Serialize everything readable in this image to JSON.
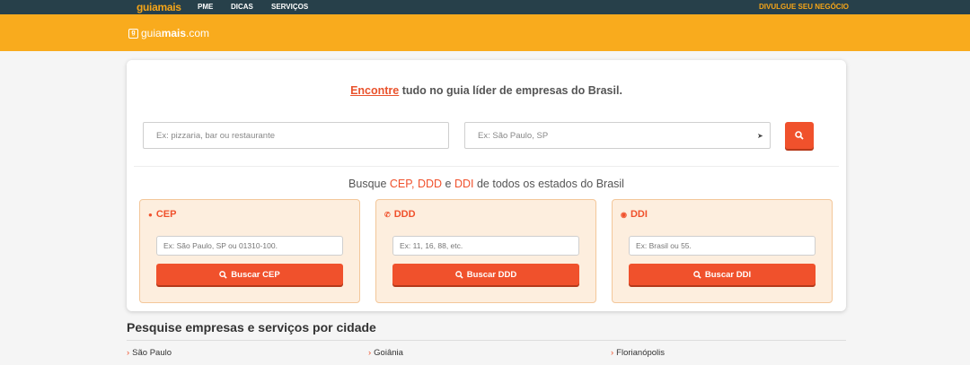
{
  "topbar": {
    "logo_a": "guia",
    "logo_b": "mais",
    "nav": [
      "PME",
      "DICAS",
      "SERVIÇOS"
    ],
    "promo": "DIVULGUE SEU NEGÓCIO"
  },
  "header": {
    "brand_a": "guia",
    "brand_b": "mais",
    "brand_c": ".com"
  },
  "hero": {
    "tagline_highlight": "Encontre",
    "tagline_rest": " tudo no guia líder de empresas do Brasil.",
    "search_placeholder": "Ex: pizzaria, bar ou restaurante",
    "location_placeholder": "Ex: São Paulo, SP"
  },
  "lookup": {
    "pre": "Busque ",
    "cep": "CEP,",
    "ddd": "DDD",
    "mid": " e ",
    "ddi": "DDI",
    "post": " de todos os estados do Brasil"
  },
  "tools": [
    {
      "title": "CEP",
      "placeholder": "Ex: São Paulo, SP ou 01310-100.",
      "button": "Buscar CEP"
    },
    {
      "title": "DDD",
      "placeholder": "Ex: 11, 16, 88, etc.",
      "button": "Buscar DDD"
    },
    {
      "title": "DDI",
      "placeholder": "Ex: Brasil ou 55.",
      "button": "Buscar DDI"
    }
  ],
  "cities": {
    "title": "Pesquise empresas e serviços por cidade",
    "items": [
      "São Paulo",
      "Goiânia",
      "Florianópolis"
    ]
  },
  "colors": {
    "accent": "#f0512c",
    "brand_yellow": "#f9ab1d",
    "topbar": "#27404a"
  }
}
